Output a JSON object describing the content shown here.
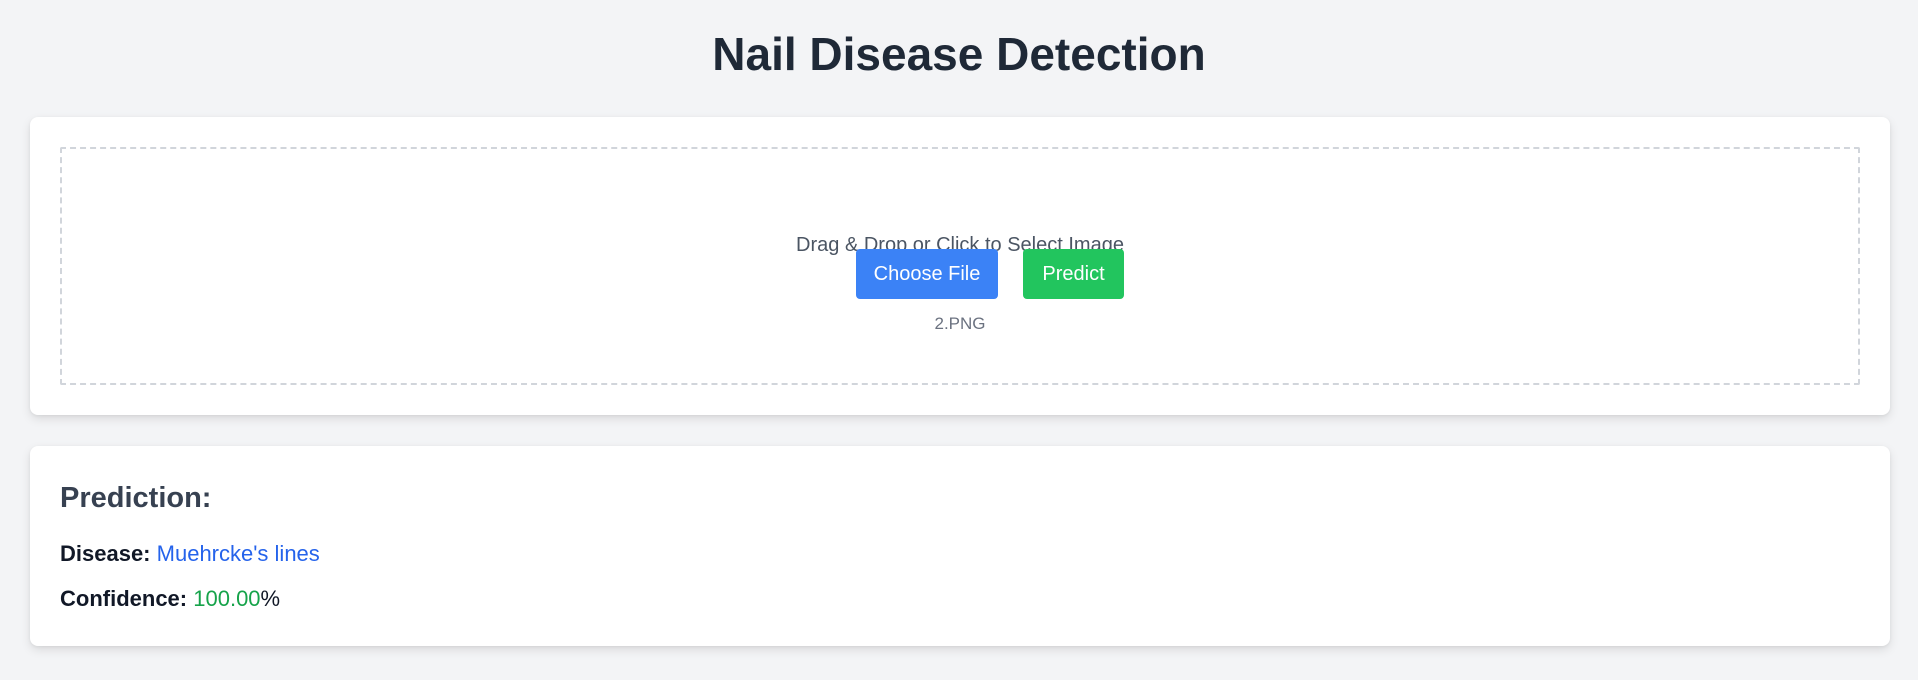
{
  "page": {
    "title": "Nail Disease Detection"
  },
  "upload": {
    "prompt": "Drag & Drop or Click to Select Image",
    "choose_label": "Choose File",
    "predict_label": "Predict",
    "selected_file": "2.PNG"
  },
  "result": {
    "heading": "Prediction:",
    "disease_label": "Disease:",
    "disease_value": "Muehrcke's lines",
    "confidence_label": "Confidence:",
    "confidence_value": "100.00",
    "confidence_unit": "%"
  },
  "colors": {
    "background": "#f3f4f6",
    "choose_button": "#3b82f6",
    "predict_button": "#22c55e",
    "disease_text": "#2563eb",
    "confidence_text": "#16a34a"
  }
}
